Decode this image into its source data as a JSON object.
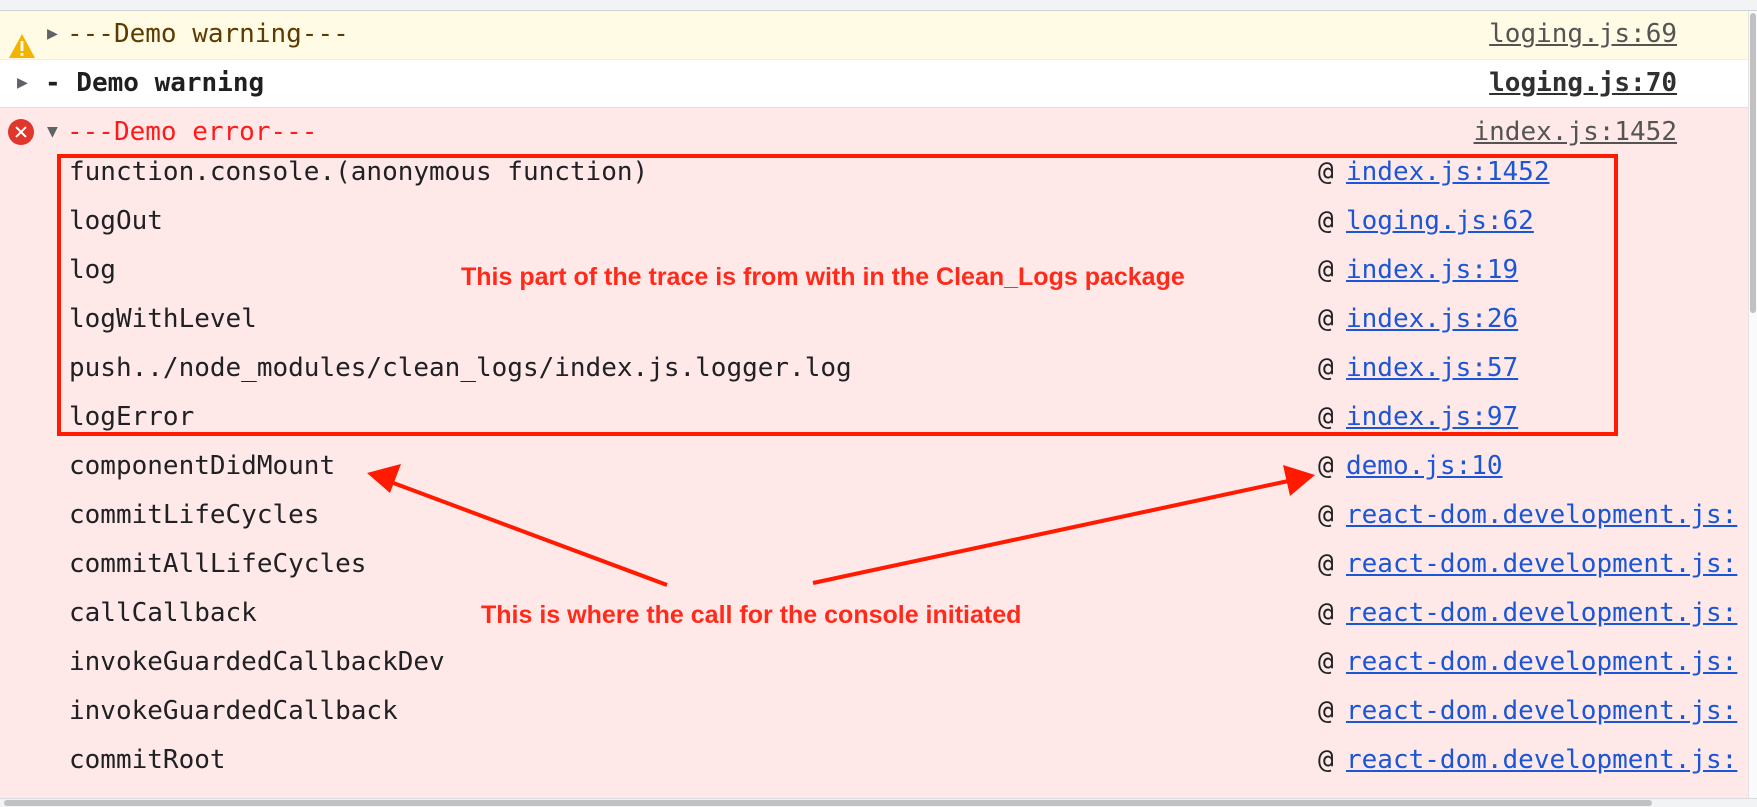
{
  "warning1": {
    "expand": "▶",
    "message": "---Demo warning---",
    "source": "loging.js:69"
  },
  "warning2": {
    "expand": "▶",
    "message": "- Demo warning",
    "source": "loging.js:70"
  },
  "error": {
    "expand": "▼",
    "message": "---Demo error---",
    "source": "index.js:1452",
    "stack": [
      {
        "fn": "function.console.(anonymous function)",
        "at": "@",
        "src": "index.js:1452"
      },
      {
        "fn": "logOut",
        "at": "@",
        "src": "loging.js:62"
      },
      {
        "fn": "log",
        "at": "@",
        "src": "index.js:19"
      },
      {
        "fn": "logWithLevel",
        "at": "@",
        "src": "index.js:26"
      },
      {
        "fn": "push../node_modules/clean_logs/index.js.logger.log",
        "at": "@",
        "src": "index.js:57"
      },
      {
        "fn": "logError",
        "at": "@",
        "src": "index.js:97"
      },
      {
        "fn": "componentDidMount",
        "at": "@",
        "src": "demo.js:10"
      },
      {
        "fn": "commitLifeCycles",
        "at": "@",
        "src": "react-dom.development.js:"
      },
      {
        "fn": "commitAllLifeCycles",
        "at": "@",
        "src": "react-dom.development.js:"
      },
      {
        "fn": "callCallback",
        "at": "@",
        "src": "react-dom.development.js:"
      },
      {
        "fn": "invokeGuardedCallbackDev",
        "at": "@",
        "src": "react-dom.development.js:"
      },
      {
        "fn": "invokeGuardedCallback",
        "at": "@",
        "src": "react-dom.development.js:"
      },
      {
        "fn": "commitRoot",
        "at": "@",
        "src": "react-dom.development.js:"
      }
    ]
  },
  "annotations": {
    "package_note": "This part of the trace is from with in the Clean_Logs package",
    "origin_note": "This is where the call for the console initiated"
  },
  "colors": {
    "annotation": "#ff2a1a",
    "error_bg": "#ffe8e8",
    "warning_bg": "#fffbe5",
    "link": "#1a56d6"
  },
  "icons": {
    "warning": "warning-icon",
    "error": "error-icon"
  }
}
